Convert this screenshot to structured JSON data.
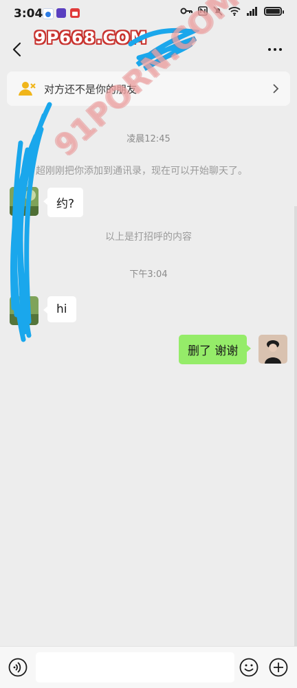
{
  "status_bar": {
    "time": "3:04",
    "notification_icons": [
      "browser-icon",
      "app-icon",
      "video-app-icon"
    ],
    "indicator_icons": [
      "key-icon",
      "nfc-icon",
      "mute-icon",
      "wifi-icon",
      "signal-icon",
      "battery-icon"
    ],
    "battery_level": 0.9
  },
  "watermark": {
    "top_text": "9P668.COM",
    "diagonal_text": "91PORN.COM"
  },
  "header": {
    "back_icon": "chevron-left-icon",
    "more_icon": "more-icon",
    "contact_name_redacted": true
  },
  "banner": {
    "icon": "user-warning-icon",
    "text": "对方还不是你的朋友",
    "arrow_icon": "chevron-right-icon"
  },
  "messages": {
    "time_1": "凌晨12:45",
    "system_added": "超刚刚把你添加到通讯录，现在可以开始聊天了。",
    "msg_1": "约?",
    "system_greeting": "以上是打招呼的内容",
    "time_2": "下午3:04",
    "msg_2": "hi",
    "msg_3": "删了 谢谢"
  },
  "input_bar": {
    "voice_icon": "voice-icon",
    "emoji_icon": "emoji-icon",
    "plus_icon": "plus-icon",
    "input_value": ""
  },
  "colors": {
    "background": "#ededed",
    "sent_bubble": "#95ec69",
    "received_bubble": "#ffffff",
    "redaction": "#1aa7ec",
    "watermark_red": "#c8332f"
  }
}
